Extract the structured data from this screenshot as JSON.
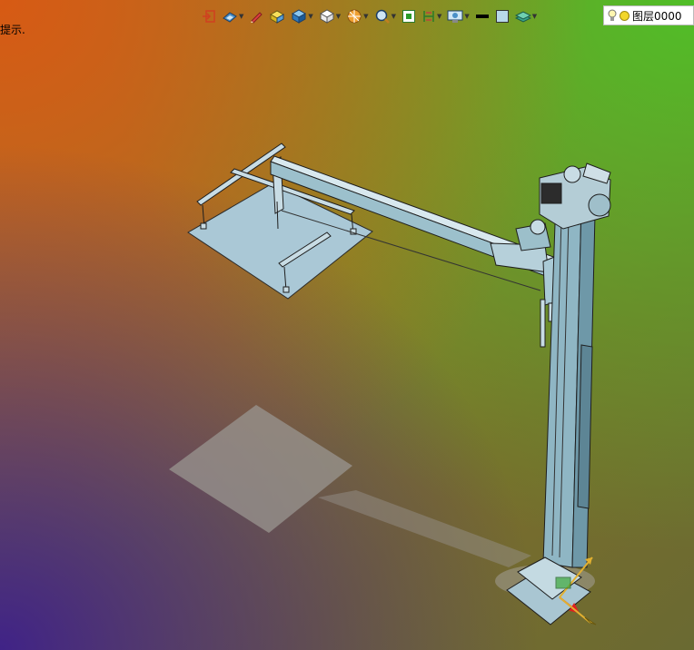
{
  "hint_text": "提示.",
  "layer": {
    "name": "图层0000",
    "bulb_icon": "lightbulb-icon",
    "color_icon": "yellow-circle-icon"
  },
  "toolbar": {
    "items": [
      {
        "icon": "exit-icon"
      },
      {
        "icon": "view-orient-icon",
        "dropdown": true
      },
      {
        "icon": "pencil-icon"
      },
      {
        "icon": "solid-box-yellow-icon"
      },
      {
        "icon": "solid-box-blue-icon",
        "dropdown": true
      },
      {
        "icon": "wire-box-icon",
        "dropdown": true
      },
      {
        "icon": "section-icon",
        "dropdown": true
      },
      {
        "icon": "zoom-icon",
        "dropdown": true
      },
      {
        "icon": "fit-view-icon"
      },
      {
        "icon": "bracket-icon",
        "dropdown": true
      },
      {
        "icon": "display-settings-icon",
        "dropdown": true
      },
      {
        "icon": "line-weight-icon"
      },
      {
        "icon": "color-swatch-icon"
      },
      {
        "icon": "layer-stack-icon",
        "dropdown": true
      }
    ]
  }
}
